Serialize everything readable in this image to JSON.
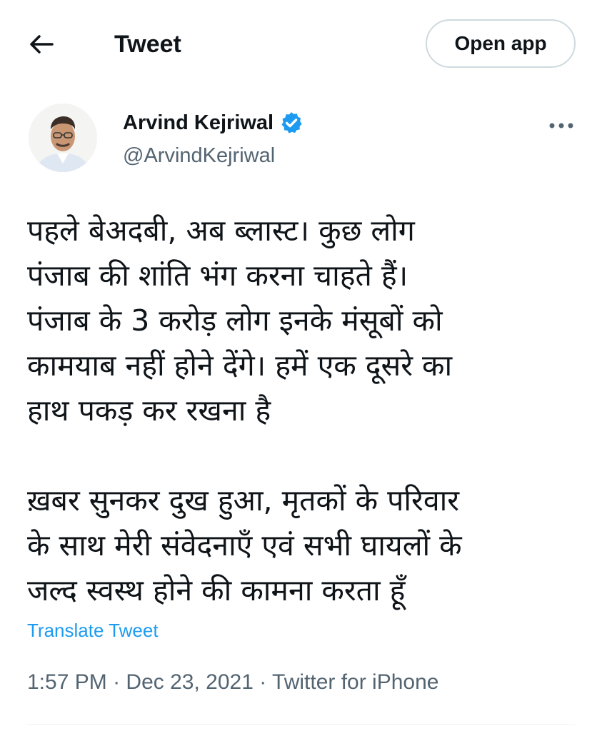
{
  "header": {
    "title": "Tweet",
    "open_app_label": "Open app",
    "back_icon": "arrow-left-icon"
  },
  "author": {
    "name": "Arvind Kejriwal",
    "handle": "@ArvindKejriwal",
    "verified": true,
    "verified_color": "#1d9bf0"
  },
  "tweet": {
    "lines": [
      "पहले बेअदबी, अब ब्लास्ट। कुछ लोग",
      "पंजाब की शांति भंग करना चाहते हैं।",
      "पंजाब के 3 करोड़ लोग इनके मंसूबों को",
      "कामयाब नहीं होने देंगे। हमें एक दूसरे का",
      "हाथ पकड़ कर रखना है",
      "",
      "ख़बर सुनकर दुख हुआ, मृतकों के परिवार",
      "के साथ मेरी संवेदनाएँ एवं सभी घायलों के",
      "जल्द स्वस्थ होने की कामना करता हूँ"
    ],
    "translate_label": "Translate Tweet",
    "time": "1:57 PM",
    "date": "Dec 23, 2021",
    "source": "Twitter for iPhone",
    "separator": "·"
  },
  "colors": {
    "text": "#0f1419",
    "secondary": "#536471",
    "accent": "#1d9bf0",
    "border": "#cfd9de"
  }
}
